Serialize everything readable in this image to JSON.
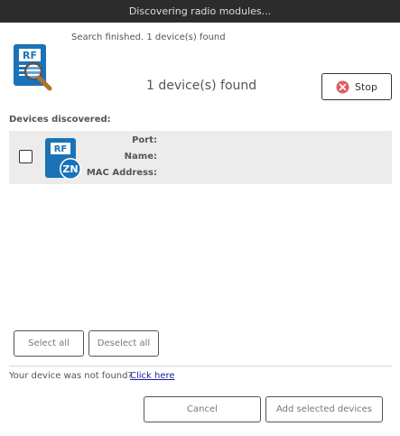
{
  "window": {
    "title": "Discovering radio modules..."
  },
  "header": {
    "status": "Search finished. 1 device(s) found",
    "found_count": "1 device(s) found",
    "search_icon": "rf-module-search-icon",
    "stop_label": "Stop",
    "stop_icon": "close-circle-icon"
  },
  "devices": {
    "section_label": "Devices discovered:",
    "items": [
      {
        "icon": "rf-zn-module-icon",
        "checked": false,
        "port_label": "Port:",
        "port_value": "",
        "name_label": "Name:",
        "name_value": "",
        "mac_label": "MAC Address:",
        "mac_value": ""
      }
    ]
  },
  "selection": {
    "select_all_label": "Select all",
    "deselect_all_label": "Deselect all"
  },
  "footer": {
    "not_found_text": "Your device was not found?",
    "click_here_label": "Click here",
    "cancel_label": "Cancel",
    "add_label": "Add selected devices"
  },
  "colors": {
    "titlebar_bg": "#2c2c2c",
    "icon_blue": "#1a73b8",
    "stop_red": "#e06060",
    "link_blue": "#1a1a9e",
    "row_bg": "#ececec"
  }
}
